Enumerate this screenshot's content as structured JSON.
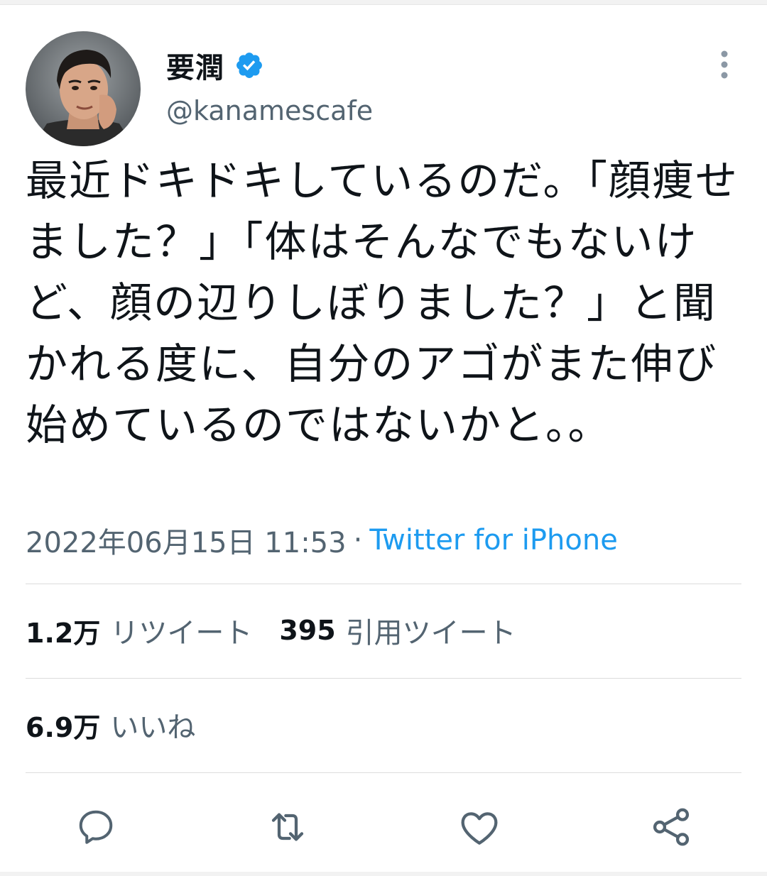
{
  "author": {
    "display_name": "要潤",
    "username": "@kanamescafe",
    "verified": true
  },
  "tweet": {
    "text": "最近ドキドキしているのだ。「顔痩せました？」「体はそんなでもないけど、顔の辺りしぼりました？」と聞かれる度に、自分のアゴがまた伸び始めているのではないかと。。",
    "timestamp": "2022年06月15日 11:53",
    "separator": "·",
    "source": "Twitter for iPhone"
  },
  "stats": {
    "retweets": {
      "count": "1.2万",
      "label": "リツイート"
    },
    "quotes": {
      "count": "395",
      "label": "引用ツイート"
    },
    "likes": {
      "count": "6.9万",
      "label": "いいね"
    }
  },
  "actions": [
    "reply-icon",
    "retweet-icon",
    "like-icon",
    "share-icon"
  ],
  "colors": {
    "text": "#0f1419",
    "secondary": "#536471",
    "link": "#1d9bf0",
    "verified": "#1d9bf0",
    "icon": "#536471"
  }
}
